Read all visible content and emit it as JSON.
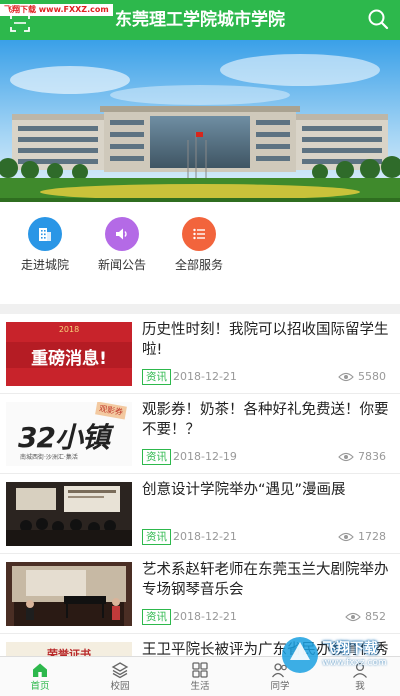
{
  "watermark": "飞翔下载 www.FXXZ.com",
  "header": {
    "title": "东莞理工学院城市学院"
  },
  "quick_links": [
    {
      "label": "走进城院",
      "icon": "building-icon",
      "color": "#2a96e6"
    },
    {
      "label": "新闻公告",
      "icon": "speaker-icon",
      "color": "#b46ae6"
    },
    {
      "label": "全部服务",
      "icon": "list-icon",
      "color": "#f2643c"
    }
  ],
  "thumbs": {
    "t1_top": "2018",
    "t1_main": "重磅消息!",
    "t2_main": "32小镇",
    "t2_sub": "南城西街·沙洲汇·集活",
    "t2_badge": "观影券",
    "t5_main": "荣誉证书"
  },
  "news": [
    {
      "title": "历史性时刻！我院可以招收国际留学生啦!",
      "tag": "资讯",
      "date": "2018-12-21",
      "views": "5580"
    },
    {
      "title": "观影券！奶茶！各种好礼免费送！你要不要！？",
      "tag": "资讯",
      "date": "2018-12-19",
      "views": "7836"
    },
    {
      "title": "创意设计学院举办“遇见”漫画展",
      "tag": "资讯",
      "date": "2018-12-21",
      "views": "1728"
    },
    {
      "title": "艺术系赵轩老师在东莞玉兰大剧院举办专场钢琴音乐会",
      "tag": "资讯",
      "date": "2018-12-21",
      "views": "852"
    },
    {
      "title": "王卫平院长被评为广东省民办教育优秀"
    }
  ],
  "tabs": [
    {
      "label": "首页",
      "icon": "home-icon",
      "active": true
    },
    {
      "label": "校园",
      "icon": "layers-icon"
    },
    {
      "label": "生活",
      "icon": "grid-icon"
    },
    {
      "label": "同学",
      "icon": "people-icon"
    },
    {
      "label": "我",
      "icon": "user-icon"
    }
  ],
  "overlay_badge": {
    "title": "飞翔下载",
    "url": "www.fxxz.com"
  },
  "colors": {
    "accent": "#2db84c",
    "tag": "#2db84c"
  }
}
